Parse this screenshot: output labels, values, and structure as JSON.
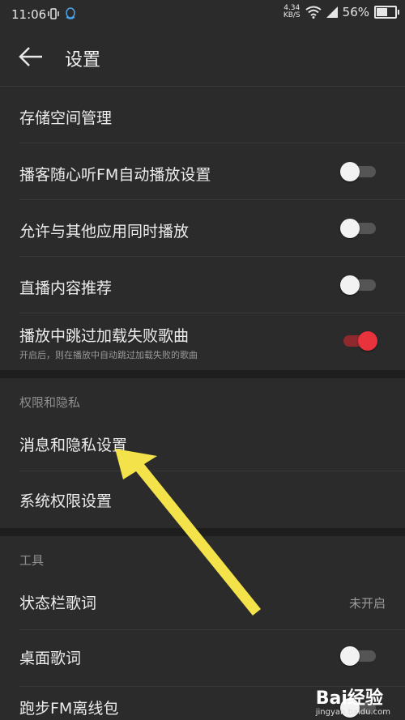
{
  "status": {
    "time": "11:06",
    "net_speed_value": "4.34",
    "net_speed_unit": "KB/S",
    "battery": "56%"
  },
  "app_bar": {
    "title": "设置"
  },
  "rows": {
    "storage": "存储空间管理",
    "podcast_fm": "播客随心听FM自动播放设置",
    "allow_play": "允许与其他应用同时播放",
    "live_recommend": "直播内容推荐",
    "skip_failed": "播放中跳过加载失败歌曲",
    "skip_failed_sub": "开启后，则在播放中自动跳过加载失败的歌曲",
    "msg_privacy": "消息和隐私设置",
    "sys_permission": "系统权限设置",
    "statusbar_lyrics": "状态栏歌词",
    "statusbar_lyrics_value": "未开启",
    "desktop_lyrics": "桌面歌词",
    "run_fm": "跑步FM离线包"
  },
  "toggles": {
    "podcast_fm": false,
    "allow_play": false,
    "live_recommend": false,
    "skip_failed": true,
    "desktop_lyrics": false,
    "run_fm": false
  },
  "sections": {
    "privacy": "权限和隐私",
    "tools": "工具"
  },
  "watermark": {
    "main": "Bai经验",
    "sub": "jingyan.baidu.com"
  },
  "colors": {
    "background": "#2b2b2b",
    "toggle_on": "#e8323c",
    "annotation_arrow": "#f3e24a"
  }
}
